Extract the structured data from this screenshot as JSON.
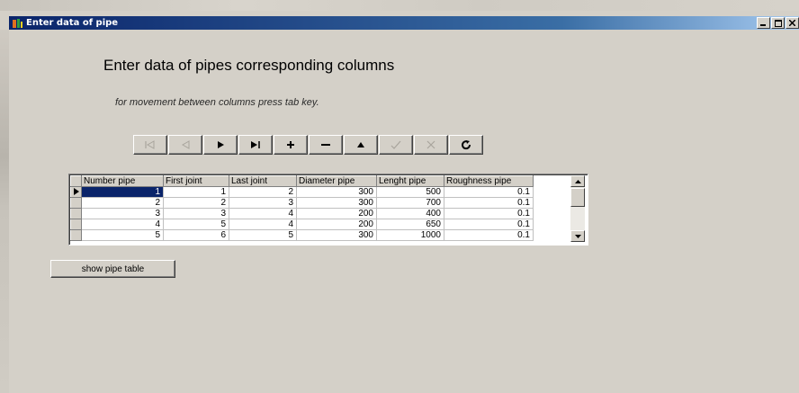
{
  "window": {
    "title": "Enter data of pipe",
    "controls": [
      "minimize",
      "maximize",
      "close"
    ]
  },
  "heading": "Enter data of pipes corresponding columns",
  "hint": "for movement between columns press tab key.",
  "navigator": {
    "buttons": [
      {
        "name": "first-record",
        "glyph": "|◁",
        "enabled": false
      },
      {
        "name": "prior-record",
        "glyph": "◁",
        "enabled": false
      },
      {
        "name": "next-record",
        "glyph": "►",
        "enabled": true
      },
      {
        "name": "last-record",
        "glyph": "►|",
        "enabled": true
      },
      {
        "name": "insert-record",
        "glyph": "✚",
        "enabled": true
      },
      {
        "name": "delete-record",
        "glyph": "━",
        "enabled": true
      },
      {
        "name": "edit-record",
        "glyph": "▲",
        "enabled": true
      },
      {
        "name": "post-edit",
        "glyph": "✓",
        "enabled": false
      },
      {
        "name": "cancel-edit",
        "glyph": "✕",
        "enabled": false
      },
      {
        "name": "refresh-data",
        "glyph": "↻",
        "enabled": true
      }
    ]
  },
  "grid": {
    "columns": [
      "Number pipe",
      "First joint",
      "Last joint",
      "Diameter pipe",
      "Lenght pipe",
      "Roughness pipe"
    ],
    "rows": [
      [
        "1",
        "1",
        "2",
        "300",
        "500",
        "0.1"
      ],
      [
        "2",
        "2",
        "3",
        "300",
        "700",
        "0.1"
      ],
      [
        "3",
        "3",
        "4",
        "200",
        "400",
        "0.1"
      ],
      [
        "4",
        "5",
        "4",
        "200",
        "650",
        "0.1"
      ],
      [
        "5",
        "6",
        "5",
        "300",
        "1000",
        "0.1"
      ]
    ],
    "current_row": 0
  },
  "show_button_label": "show pipe table",
  "colors": {
    "title_bar": "#0a246a",
    "face": "#d4d0c8",
    "selection": "#0a246a"
  }
}
